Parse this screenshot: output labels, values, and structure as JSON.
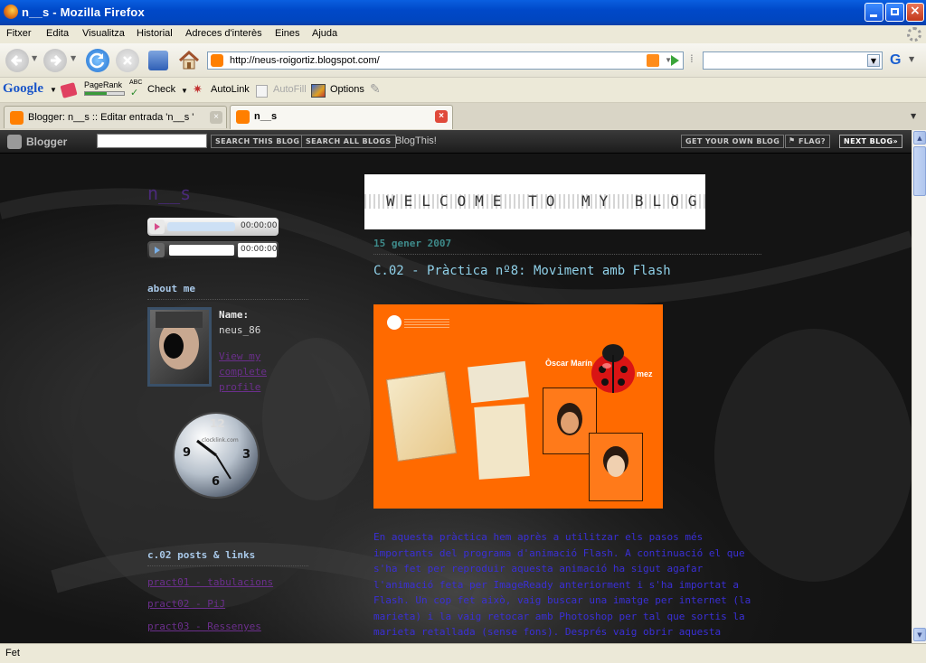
{
  "window": {
    "title": "n__s - Mozilla Firefox"
  },
  "menu": [
    "Fitxer",
    "Edita",
    "Visualitza",
    "Historial",
    "Adreces d'interès",
    "Eines",
    "Ajuda"
  ],
  "navigation": {
    "url": "http://neus-roigortiz.blogspot.com/"
  },
  "google_toolbar": {
    "logo": "Google",
    "pagerank": "PageRank",
    "abc": "ABC",
    "check": "Check",
    "autolink": "AutoLink",
    "autofill": "AutoFill",
    "options": "Options"
  },
  "tabs": [
    {
      "label": "Blogger: n__s :: Editar entrada 'n__s '",
      "active": false
    },
    {
      "label": "n__s",
      "active": true
    }
  ],
  "blogger_bar": {
    "brand": "Blogger",
    "search_blog": "SEARCH THIS BLOG",
    "search_all": "SEARCH ALL BLOGS",
    "blogthis": "BlogThis!",
    "get_own": "GET YOUR OWN BLOG",
    "flag": "FLAG?",
    "next_blog": "NEXT BLOG»"
  },
  "sidebar": {
    "blog_title": "n__s",
    "players": [
      {
        "time": "00:00:00"
      },
      {
        "time": "00:00:00"
      }
    ],
    "about_heading": "about me",
    "name_label": "Name:",
    "name_value": "neus_86",
    "profile_link": "View my complete profile",
    "clock_numbers": {
      "n12": "12",
      "n3": "3",
      "n6": "6",
      "n9": "9"
    },
    "clock_brand": "clocklink.com",
    "posts_heading": "c.02 posts & links",
    "links": [
      "pract01 - tabulacions",
      "pract02 - PiJ",
      "pract03 - Ressenyes"
    ]
  },
  "main": {
    "banner_text": "WELCOME TO MY BLOG",
    "date": "15 gener 2007",
    "post_title": "C.02 - Pràctica nº8: Moviment amb Flash",
    "image_name": "Òscar Marín",
    "image_name_tail": "mez",
    "post_body": "En aquesta pràctica hem après a utilitzar els pasos més importants del programa d'animació Flash. A continuació el que s'ha fet per reproduir aquesta animació ha sigut agafar l'animació feta per ImageReady anteriorment i s'ha importat a Flash. Un cop fet això, vaig buscar una imatge per internet (la marieta) i la vaig retocar amb Photoshop per tal que sortis la marieta retallada (sense fons). Després vaig obrir aquesta imatge a ImageReady i la vaig guardar amb l'extensió \"fla\" i la vaig afegir"
  },
  "status": {
    "text": "Fet"
  },
  "colors": {
    "accent_link": "#6b2f8c",
    "body_text": "#3a2fd6",
    "date": "#3e8a8a",
    "title": "#8fd0e8",
    "image_bg": "#ff6a00"
  }
}
